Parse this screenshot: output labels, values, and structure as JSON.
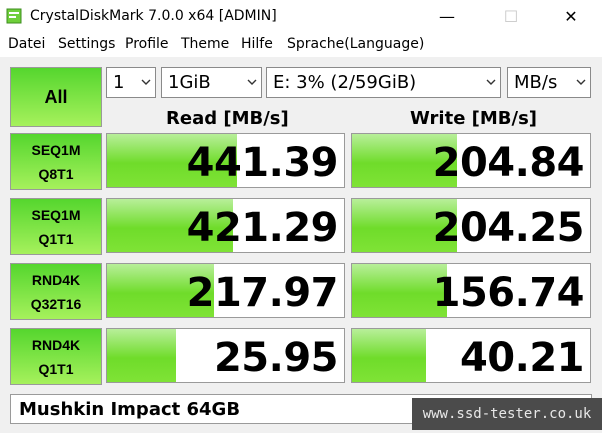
{
  "window": {
    "title": "CrystalDiskMark 7.0.0 x64 [ADMIN]"
  },
  "menu": [
    "Datei",
    "Settings",
    "Profile",
    "Theme",
    "Hilfe",
    "Sprache(Language)"
  ],
  "controls": {
    "all_label": "All",
    "count": "1",
    "size": "1GiB",
    "drive": "E: 3% (2/59GiB)",
    "unit": "MB/s"
  },
  "headers": {
    "read": "Read [MB/s]",
    "write": "Write [MB/s]"
  },
  "tests": [
    {
      "line1": "SEQ1M",
      "line2": "Q8T1",
      "read": "441.39",
      "write": "204.84",
      "read_fill": 0.55,
      "write_fill": 0.44
    },
    {
      "line1": "SEQ1M",
      "line2": "Q1T1",
      "read": "421.29",
      "write": "204.25",
      "read_fill": 0.53,
      "write_fill": 0.44
    },
    {
      "line1": "RND4K",
      "line2": "Q32T16",
      "read": "217.97",
      "write": "156.74",
      "read_fill": 0.45,
      "write_fill": 0.4
    },
    {
      "line1": "RND4K",
      "line2": "Q1T1",
      "read": "25.95",
      "write": "40.21",
      "read_fill": 0.29,
      "write_fill": 0.31
    }
  ],
  "comment": "Mushkin Impact 64GB",
  "watermark": "www.ssd-tester.co.uk",
  "colors": {
    "accent_green": "#55d62e",
    "bar_green": "#6fdc2a"
  }
}
